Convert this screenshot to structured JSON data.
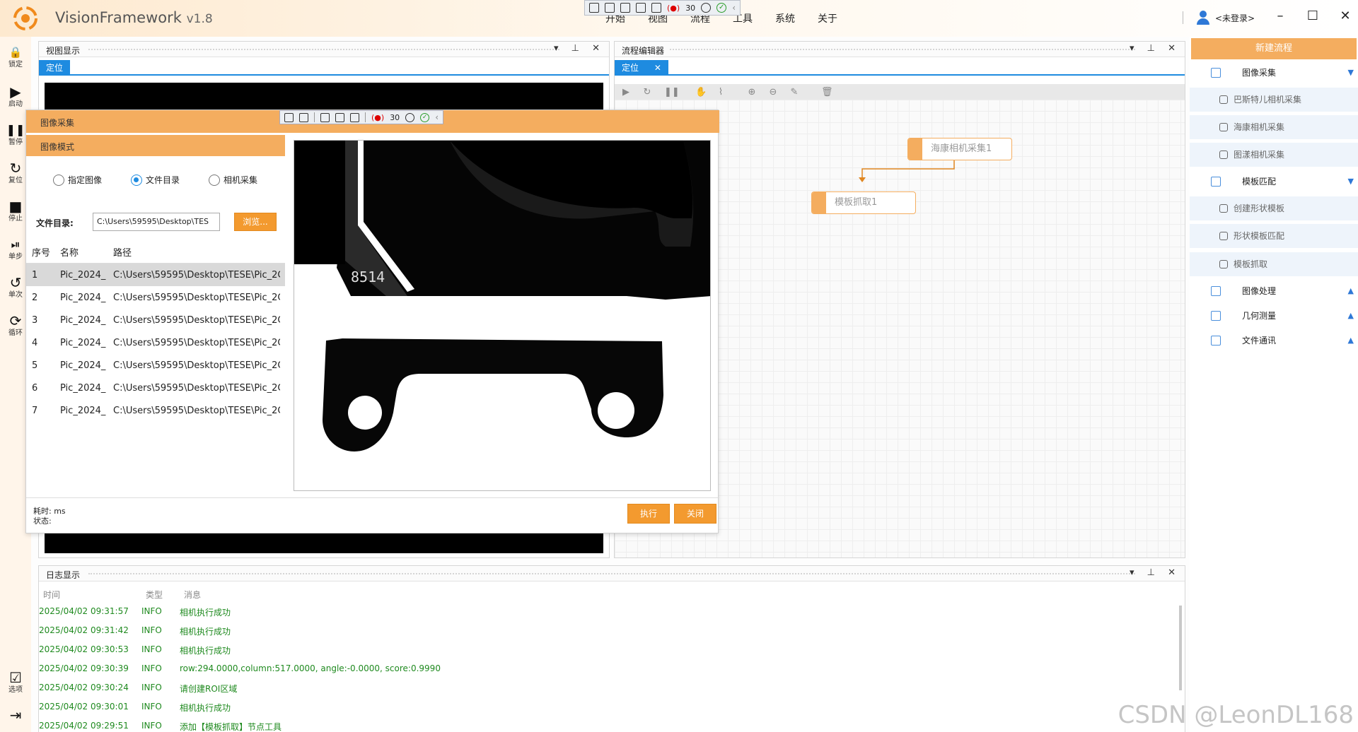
{
  "app": {
    "name": "VisionFramework",
    "version": "v1.8"
  },
  "menu": [
    "开始",
    "视图",
    "流程",
    "工具",
    "系统",
    "关于"
  ],
  "float_toolbar": {
    "count": "30"
  },
  "user": {
    "name": "<未登录>"
  },
  "window_controls": {
    "minimize": "–",
    "maximize": "☐",
    "close": "✕"
  },
  "left_toolbar": [
    {
      "icon": "lock-icon",
      "glyph": "🔒",
      "label": "锁定"
    },
    {
      "icon": "play-icon",
      "glyph": "▶",
      "label": "启动"
    },
    {
      "icon": "pause-icon",
      "glyph": "❚❚",
      "label": "暂停"
    },
    {
      "icon": "reset-icon",
      "glyph": "↻",
      "label": "复位"
    },
    {
      "icon": "stop-icon",
      "glyph": "■",
      "label": "停止"
    },
    {
      "icon": "step-icon",
      "glyph": "⏯",
      "label": "单步"
    },
    {
      "icon": "once-icon",
      "glyph": "↺",
      "label": "单次"
    },
    {
      "icon": "loop-icon",
      "glyph": "⟳",
      "label": "循环"
    },
    {
      "icon": "options-icon",
      "glyph": "☑",
      "label": "选项"
    },
    {
      "icon": "exit-icon",
      "glyph": "⇥",
      "label": ""
    }
  ],
  "view_panel": {
    "title": "视图显示",
    "tab": "定位"
  },
  "dialog": {
    "title": "图像采集",
    "mode_title": "图像模式",
    "toolbar_count": "30",
    "radios": [
      {
        "label": "指定图像",
        "checked": false
      },
      {
        "label": "文件目录",
        "checked": true
      },
      {
        "label": "相机采集",
        "checked": false
      }
    ],
    "dir_label": "文件目录:",
    "dir_value": "C:\\Users\\59595\\Desktop\\TES",
    "browse": "浏览...",
    "columns": [
      "序号",
      "名称",
      "路径"
    ],
    "rows": [
      {
        "no": "1",
        "name": "Pic_2024_",
        "path": "C:\\Users\\59595\\Desktop\\TESE\\Pic_2C",
        "selected": true
      },
      {
        "no": "2",
        "name": "Pic_2024_",
        "path": "C:\\Users\\59595\\Desktop\\TESE\\Pic_2C",
        "selected": false
      },
      {
        "no": "3",
        "name": "Pic_2024_",
        "path": "C:\\Users\\59595\\Desktop\\TESE\\Pic_2C",
        "selected": false
      },
      {
        "no": "4",
        "name": "Pic_2024_",
        "path": "C:\\Users\\59595\\Desktop\\TESE\\Pic_2C",
        "selected": false
      },
      {
        "no": "5",
        "name": "Pic_2024_",
        "path": "C:\\Users\\59595\\Desktop\\TESE\\Pic_2C",
        "selected": false
      },
      {
        "no": "6",
        "name": "Pic_2024_",
        "path": "C:\\Users\\59595\\Desktop\\TESE\\Pic_2C",
        "selected": false
      },
      {
        "no": "7",
        "name": "Pic_2024_",
        "path": "C:\\Users\\59595\\Desktop\\TESE\\Pic_2C",
        "selected": false
      }
    ],
    "image_text": "8514",
    "elapsed": "耗时:  ms",
    "status": "状态:",
    "run": "执行",
    "close": "关闭"
  },
  "flow_panel": {
    "title": "流程编辑器",
    "tab": "定位",
    "tab_close": "✕",
    "nodes": [
      "海康相机采集1",
      "模板抓取1"
    ]
  },
  "toolbox": {
    "new_flow": "新建流程",
    "items": [
      {
        "label": "图像采集",
        "type": "cat",
        "arrow": "▼"
      },
      {
        "label": "巴斯特儿相机采集",
        "type": "sub"
      },
      {
        "label": "海康相机采集",
        "type": "sub"
      },
      {
        "label": "图漾相机采集",
        "type": "sub"
      },
      {
        "label": "模板匹配",
        "type": "cat",
        "arrow": "▼"
      },
      {
        "label": "创建形状模板",
        "type": "sub"
      },
      {
        "label": "形状模板匹配",
        "type": "sub"
      },
      {
        "label": "模板抓取",
        "type": "sub"
      },
      {
        "label": "图像处理",
        "type": "cat",
        "arrow": "▲"
      },
      {
        "label": "几何测量",
        "type": "cat",
        "arrow": "▲"
      },
      {
        "label": "文件通讯",
        "type": "cat",
        "arrow": "▲"
      }
    ]
  },
  "log_panel": {
    "title": "日志显示",
    "columns": [
      "时间",
      "类型",
      "消息"
    ],
    "rows": [
      {
        "time": "2025/04/02 09:31:57",
        "type": "INFO",
        "msg": "相机执行成功"
      },
      {
        "time": "2025/04/02 09:31:42",
        "type": "INFO",
        "msg": "相机执行成功"
      },
      {
        "time": "2025/04/02 09:30:53",
        "type": "INFO",
        "msg": "相机执行成功"
      },
      {
        "time": "2025/04/02 09:30:39",
        "type": "INFO",
        "msg": "row:294.0000,column:517.0000, angle:-0.0000, score:0.9990"
      },
      {
        "time": "2025/04/02 09:30:24",
        "type": "INFO",
        "msg": "请创建ROI区域"
      },
      {
        "time": "2025/04/02 09:30:01",
        "type": "INFO",
        "msg": "相机执行成功"
      },
      {
        "time": "2025/04/02 09:29:51",
        "type": "INFO",
        "msg": "添加【模板抓取】节点工具"
      }
    ]
  },
  "watermark": "CSDN @LeonDL168",
  "colors": {
    "accent": "#f4ad5f",
    "primary": "#1e8be0",
    "log_text": "#1f8a1f"
  }
}
